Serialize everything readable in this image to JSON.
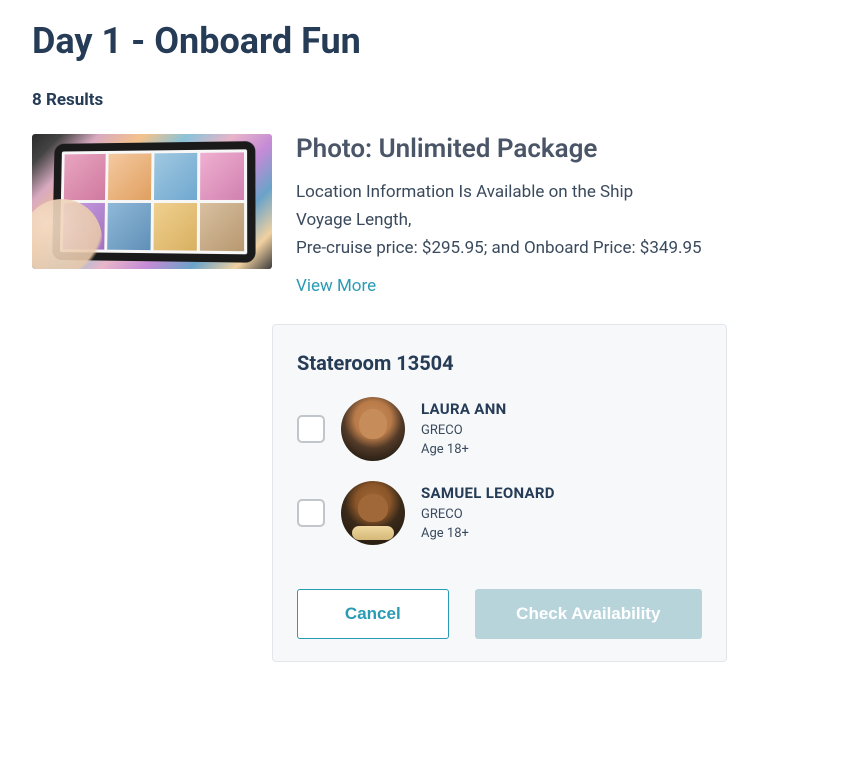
{
  "header": {
    "title": "Day 1 - Onboard Fun",
    "results_label": "8 Results"
  },
  "product": {
    "title": "Photo: Unlimited Package",
    "line1": "Location Information Is Available on the Ship",
    "line2": "Voyage Length,",
    "line3": "Pre-cruise price: $295.95; and Onboard Price: $349.95",
    "view_more_label": "View More"
  },
  "panel": {
    "stateroom_label": "Stateroom 13504",
    "guests": [
      {
        "first": "LAURA ANN",
        "last": "GRECO",
        "age": "Age 18+"
      },
      {
        "first": "SAMUEL LEONARD",
        "last": "GRECO",
        "age": "Age 18+"
      }
    ],
    "cancel_label": "Cancel",
    "check_label": "Check Availability"
  }
}
